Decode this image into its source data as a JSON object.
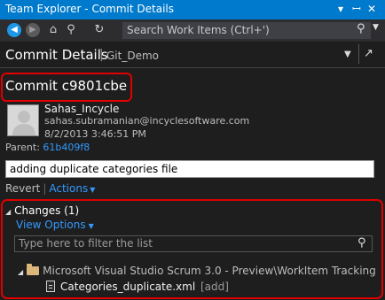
{
  "window": {
    "title": "Team Explorer - Commit Details",
    "controls": [
      "▾",
      "ᅟ",
      "×"
    ]
  },
  "toolbar": {
    "search_placeholder": "Search Work Items (Ctrl+')"
  },
  "header": {
    "title": "Commit Details",
    "separator": "|",
    "repo": "Git_Demo"
  },
  "commit": {
    "id_label": "Commit c9801cbe",
    "author": "Sahas_Incycle",
    "email": "sahas.subramanian@incyclesoftware.com",
    "date": "8/2/2013 3:46:51 PM",
    "parent_label": "Parent:",
    "parent_hash": "61b409f8",
    "message": "adding duplicate categories file"
  },
  "actions": {
    "revert": "Revert",
    "actions": "Actions"
  },
  "changes": {
    "header": "Changes (1)",
    "view_options": "View Options",
    "filter_placeholder": "Type here to filter the list",
    "folder": "Microsoft Visual Studio Scrum 3.0 - Preview\\WorkItem Tracking",
    "file_name": "Categories_duplicate.xml",
    "file_status": "[add]"
  },
  "colors": {
    "accent": "#007acc",
    "link": "#3399ff",
    "highlight_border": "#e00000",
    "background": "#1e1e1e"
  }
}
